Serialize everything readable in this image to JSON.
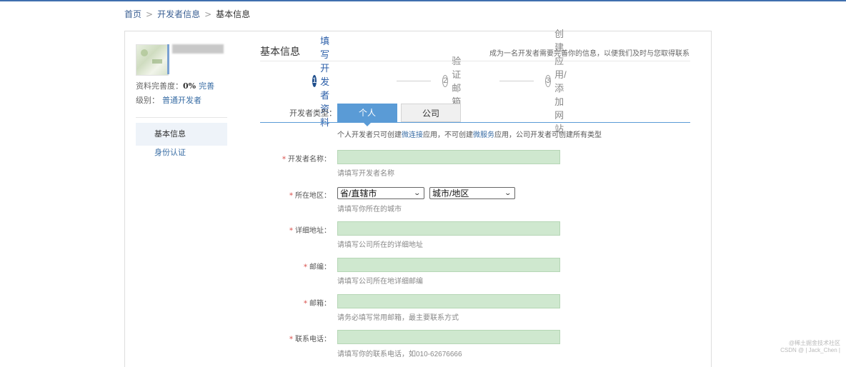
{
  "breadcrumb": [
    "首页",
    "开发者信息",
    "基本信息"
  ],
  "profile": {
    "completeness_label": "资料完善度：",
    "completeness_value": "0%",
    "complete_link": "完善",
    "level_label": "级别：",
    "level_value": "普通开发者"
  },
  "sidebar": {
    "items": [
      {
        "label": "基本信息"
      },
      {
        "label": "身份认证"
      }
    ]
  },
  "main": {
    "title": "基本信息",
    "note": "成为一名开发者需要完善你的信息，以便我们及时与您取得联系",
    "steps": [
      {
        "num": "1",
        "label": "填写开发者资料"
      },
      {
        "num": "2",
        "label": "验证邮箱"
      },
      {
        "num": "3",
        "label": "创建应用/添加网站"
      }
    ],
    "type_label": "开发者类型：",
    "tabs": [
      "个人",
      "公司"
    ],
    "type_desc_a": "个人开发者只可创建",
    "type_desc_link1": "微连接",
    "type_desc_b": "应用，不可创建",
    "type_desc_link2": "微服务",
    "type_desc_c": "应用，公司开发者可创建所有类型"
  },
  "form": {
    "name": {
      "label": "开发者名称：",
      "hint": "请填写开发者名称"
    },
    "region": {
      "label": "所在地区：",
      "province": "省/直辖市",
      "city": "城市/地区",
      "hint": "请填写你所在的城市"
    },
    "address": {
      "label": "详细地址：",
      "hint": "请填写公司所在的详细地址"
    },
    "postcode": {
      "label": "邮编：",
      "hint": "请填写公司所在地详细邮编"
    },
    "email": {
      "label": "邮箱：",
      "hint": "请务必填写常用邮箱，最主要联系方式"
    },
    "phone": {
      "label": "联系电话：",
      "hint_a": "请填写你的联系电话，如",
      "hint_b": "010-62676666"
    }
  },
  "watermark": {
    "line1": "@稀土掘金技术社区",
    "line2": "CSDN @ | Jack_Chen |"
  },
  "colors": {
    "accent": "#5a9bd6",
    "field_bg": "#cfe8cf",
    "link": "#3a6ea5",
    "required": "#d9534f"
  }
}
